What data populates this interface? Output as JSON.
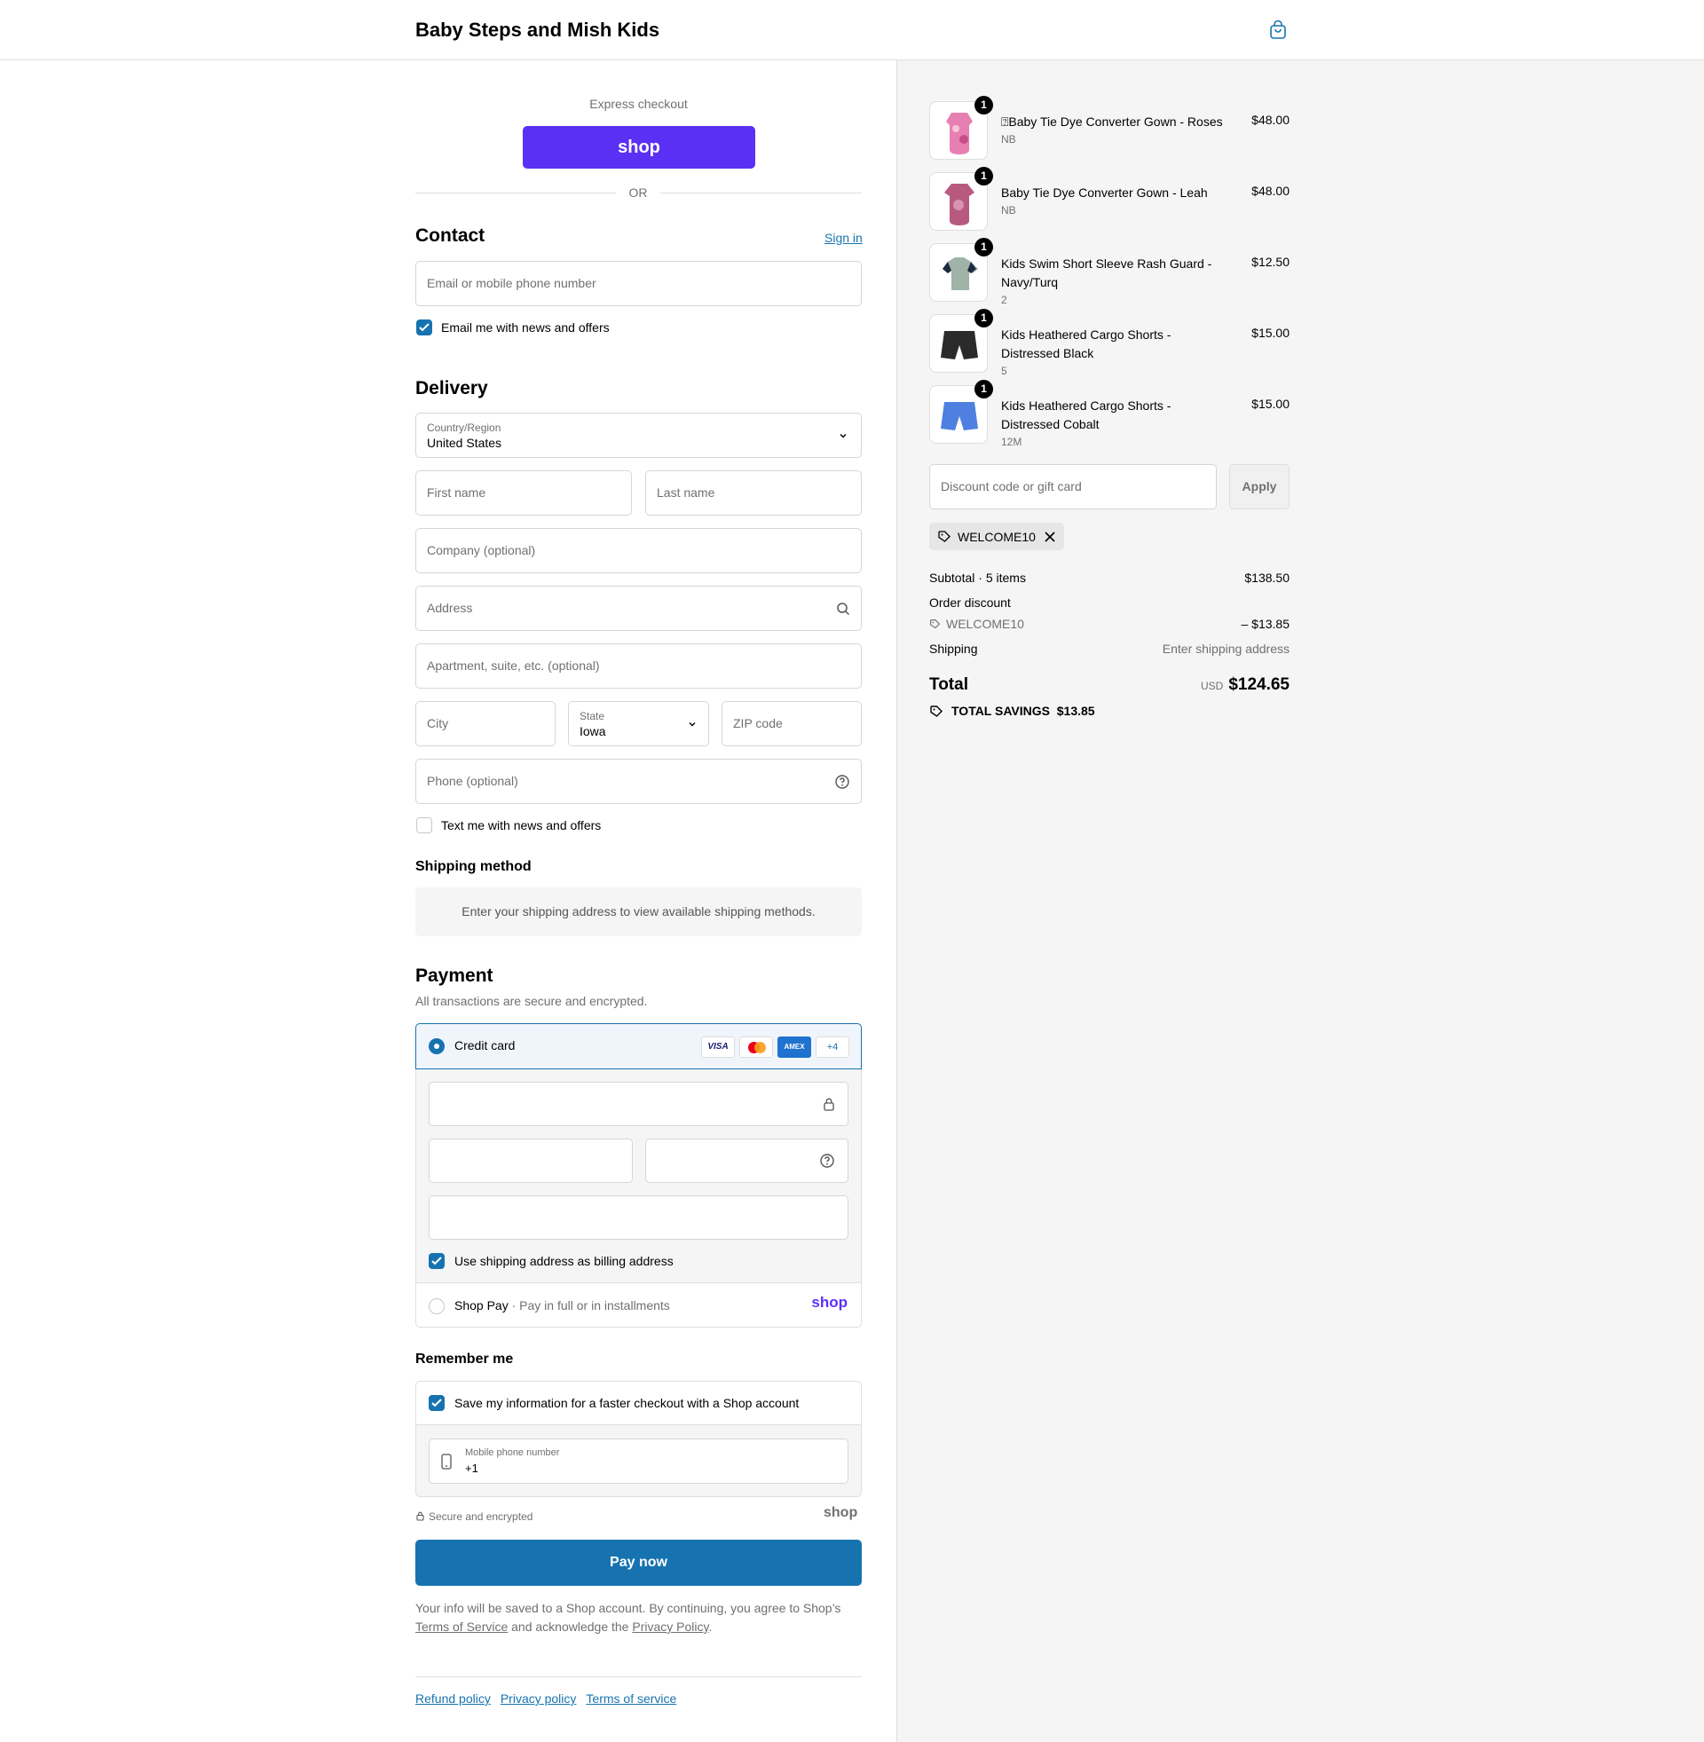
{
  "store_name": "Baby Steps and Mish Kids",
  "express": {
    "label": "Express checkout",
    "shop_button": "shop",
    "or": "OR"
  },
  "contact": {
    "title": "Contact",
    "sign_in": "Sign in",
    "email_placeholder": "Email or mobile phone number",
    "news_label": "Email me with news and offers",
    "news_checked": true
  },
  "delivery": {
    "title": "Delivery",
    "country_label": "Country/Region",
    "country_value": "United States",
    "first_name": "First name",
    "last_name": "Last name",
    "company": "Company (optional)",
    "address": "Address",
    "apartment": "Apartment, suite, etc. (optional)",
    "city": "City",
    "state_label": "State",
    "state_value": "Iowa",
    "zip": "ZIP code",
    "phone": "Phone (optional)",
    "text_label": "Text me with news and offers"
  },
  "shipping_method": {
    "title": "Shipping method",
    "message": "Enter your shipping address to view available shipping methods."
  },
  "payment": {
    "title": "Payment",
    "subtitle": "All transactions are secure and encrypted.",
    "credit_card": "Credit card",
    "card_brands": [
      "VISA",
      "MC",
      "AMEX",
      "+4"
    ],
    "billing_label": "Use shipping address as billing address",
    "shop_pay": "Shop Pay",
    "shop_pay_sub": "Pay in full or in installments",
    "shop_logo": "shop"
  },
  "remember": {
    "title": "Remember me",
    "save_label": "Save my information for a faster checkout with a Shop account",
    "phone_label": "Mobile phone number",
    "phone_value": "+1",
    "secure": "Secure and encrypted",
    "shop_logo": "shop"
  },
  "pay_button": "Pay now",
  "legal": {
    "text1": "Your info will be saved to a Shop account. By continuing, you agree to Shop’s",
    "tos": "Terms of Service",
    "mid": "and acknowledge the",
    "privacy": "Privacy Policy",
    "end": "."
  },
  "footer_links": [
    "Refund policy",
    "Privacy policy",
    "Terms of service"
  ],
  "cart": {
    "items": [
      {
        "name": "⍰Baby Tie Dye Converter Gown - Roses",
        "variant": "NB",
        "price": "$48.00",
        "qty": "1",
        "thumb_color": "#e77fb0"
      },
      {
        "name": "Baby Tie Dye Converter Gown - Leah",
        "variant": "NB",
        "price": "$48.00",
        "qty": "1",
        "thumb_color": "#b85a7e"
      },
      {
        "name": "Kids Swim Short Sleeve Rash Guard - Navy/Turq",
        "variant": "2",
        "price": "$12.50",
        "qty": "1",
        "thumb_color": "#9fb3a8"
      },
      {
        "name": "Kids Heathered Cargo Shorts - Distressed Black",
        "variant": "5",
        "price": "$15.00",
        "qty": "1",
        "thumb_color": "#2b2b2b"
      },
      {
        "name": "Kids Heathered Cargo Shorts - Distressed Cobalt",
        "variant": "12M",
        "price": "$15.00",
        "qty": "1",
        "thumb_color": "#4f7fe0"
      }
    ],
    "discount_placeholder": "Discount code or gift card",
    "apply": "Apply",
    "code": "WELCOME10",
    "subtotal_label": "Subtotal · 5 items",
    "subtotal": "$138.50",
    "order_discount": "Order discount",
    "discount_code": "WELCOME10",
    "discount_value": "– $13.85",
    "shipping_label": "Shipping",
    "shipping_value": "Enter shipping address",
    "total_label": "Total",
    "currency": "USD",
    "total": "$124.65",
    "savings_label": "TOTAL SAVINGS",
    "savings": "$13.85"
  },
  "colors": {
    "accent": "#1773b0",
    "shop_purple": "#5a31f4",
    "sidebar_bg": "#f5f5f5"
  }
}
